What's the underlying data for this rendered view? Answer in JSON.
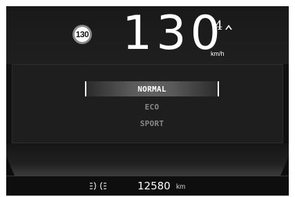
{
  "speed_limit": {
    "value": "130"
  },
  "speed": {
    "value": "130",
    "unit": "km/h"
  },
  "gear": {
    "value": "4",
    "indicator": "up-arrow-icon"
  },
  "drive_modes": {
    "items": [
      {
        "label": "NORMAL",
        "selected": true
      },
      {
        "label": "ECO",
        "selected": false
      },
      {
        "label": "SPORT",
        "selected": false
      }
    ]
  },
  "odometer": {
    "value": "12580",
    "unit": "km"
  },
  "status_icons": {
    "lights": "parking-lights-icon"
  },
  "colors": {
    "background": "#111111",
    "text_active": "#ffffff",
    "text_inactive": "#8a8a8a"
  }
}
